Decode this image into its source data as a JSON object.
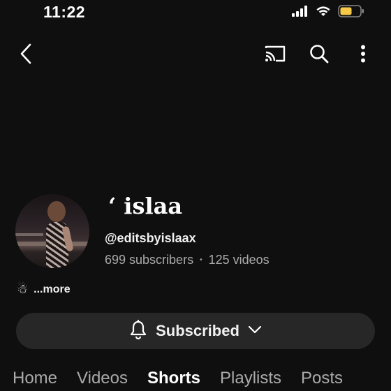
{
  "status_bar": {
    "time": "11:22",
    "icons": [
      "cellular-signal-icon",
      "wifi-icon",
      "battery-icon"
    ],
    "battery_color": "#f7c948"
  },
  "top_bar": {
    "icons": [
      "back-icon",
      "cast-icon",
      "search-icon",
      "more-vert-icon"
    ]
  },
  "channel": {
    "name": "ʻ islaa",
    "handle": "@editsbyislaax",
    "subscribers": "699 subscribers",
    "separator": "•",
    "videos": "125 videos",
    "description_icon": "☃",
    "more_label": "...more"
  },
  "subscribe_button": {
    "label": "Subscribed",
    "icons": [
      "bell-icon",
      "chevron-down-icon"
    ]
  },
  "tabs": [
    {
      "label": "Home",
      "active": false
    },
    {
      "label": "Videos",
      "active": false
    },
    {
      "label": "Shorts",
      "active": true
    },
    {
      "label": "Playlists",
      "active": false
    },
    {
      "label": "Posts",
      "active": false
    }
  ],
  "colors": {
    "background": "#0f0f0f",
    "button_bg": "#272727",
    "text_primary": "#f1f1f1",
    "text_secondary": "#aaaaaa"
  }
}
